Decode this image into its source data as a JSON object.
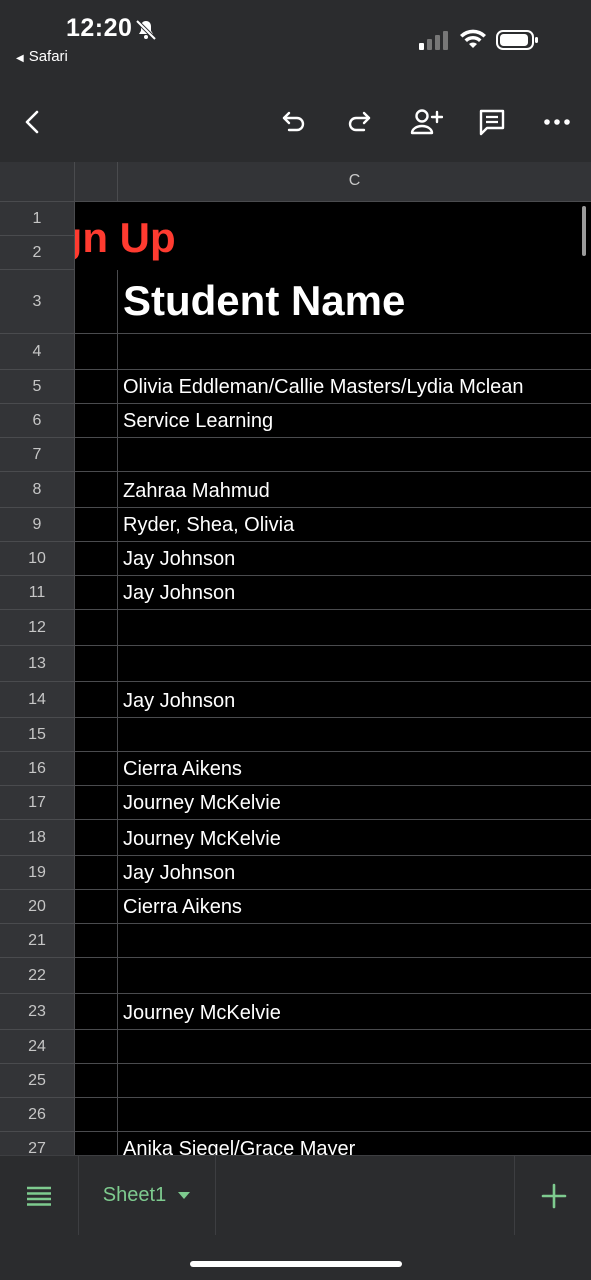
{
  "status": {
    "time": "12:20",
    "back_app": "Safari"
  },
  "toolbar": {
    "back": "back-icon",
    "undo": "undo-icon",
    "redo": "redo-icon",
    "share": "add-person-icon",
    "comment": "comment-icon",
    "more": "more-icon"
  },
  "grid": {
    "column_label": "C",
    "title": "Sign Up",
    "rows": [
      {
        "n": "1",
        "c": ""
      },
      {
        "n": "2",
        "c": ""
      },
      {
        "n": "3",
        "c": "Student Name"
      },
      {
        "n": "4",
        "c": ""
      },
      {
        "n": "5",
        "c": "Olivia Eddleman/Callie Masters/Lydia Mclean"
      },
      {
        "n": "6",
        "c": "Service Learning"
      },
      {
        "n": "7",
        "c": ""
      },
      {
        "n": "8",
        "c": "Zahraa Mahmud"
      },
      {
        "n": "9",
        "c": "Ryder, Shea, Olivia"
      },
      {
        "n": "10",
        "c": "Jay Johnson"
      },
      {
        "n": "11",
        "c": "Jay Johnson"
      },
      {
        "n": "12",
        "c": ""
      },
      {
        "n": "13",
        "c": ""
      },
      {
        "n": "14",
        "c": "Jay Johnson"
      },
      {
        "n": "15",
        "c": ""
      },
      {
        "n": "16",
        "c": "Cierra Aikens"
      },
      {
        "n": "17",
        "c": "Journey McKelvie"
      },
      {
        "n": "18",
        "c": "Journey McKelvie"
      },
      {
        "n": "19",
        "c": "Jay Johnson"
      },
      {
        "n": "20",
        "c": "Cierra Aikens"
      },
      {
        "n": "21",
        "c": ""
      },
      {
        "n": "22",
        "c": ""
      },
      {
        "n": "23",
        "c": "Journey McKelvie"
      },
      {
        "n": "24",
        "c": ""
      },
      {
        "n": "25",
        "c": ""
      },
      {
        "n": "26",
        "c": ""
      },
      {
        "n": "27",
        "c": "Anika Siegel/Grace Mayer"
      }
    ]
  },
  "sheets": {
    "active": "Sheet1",
    "accent": "#7ecb8f"
  },
  "colors": {
    "header_bg": "#2b2c2e",
    "title_red": "#ff3b30"
  }
}
